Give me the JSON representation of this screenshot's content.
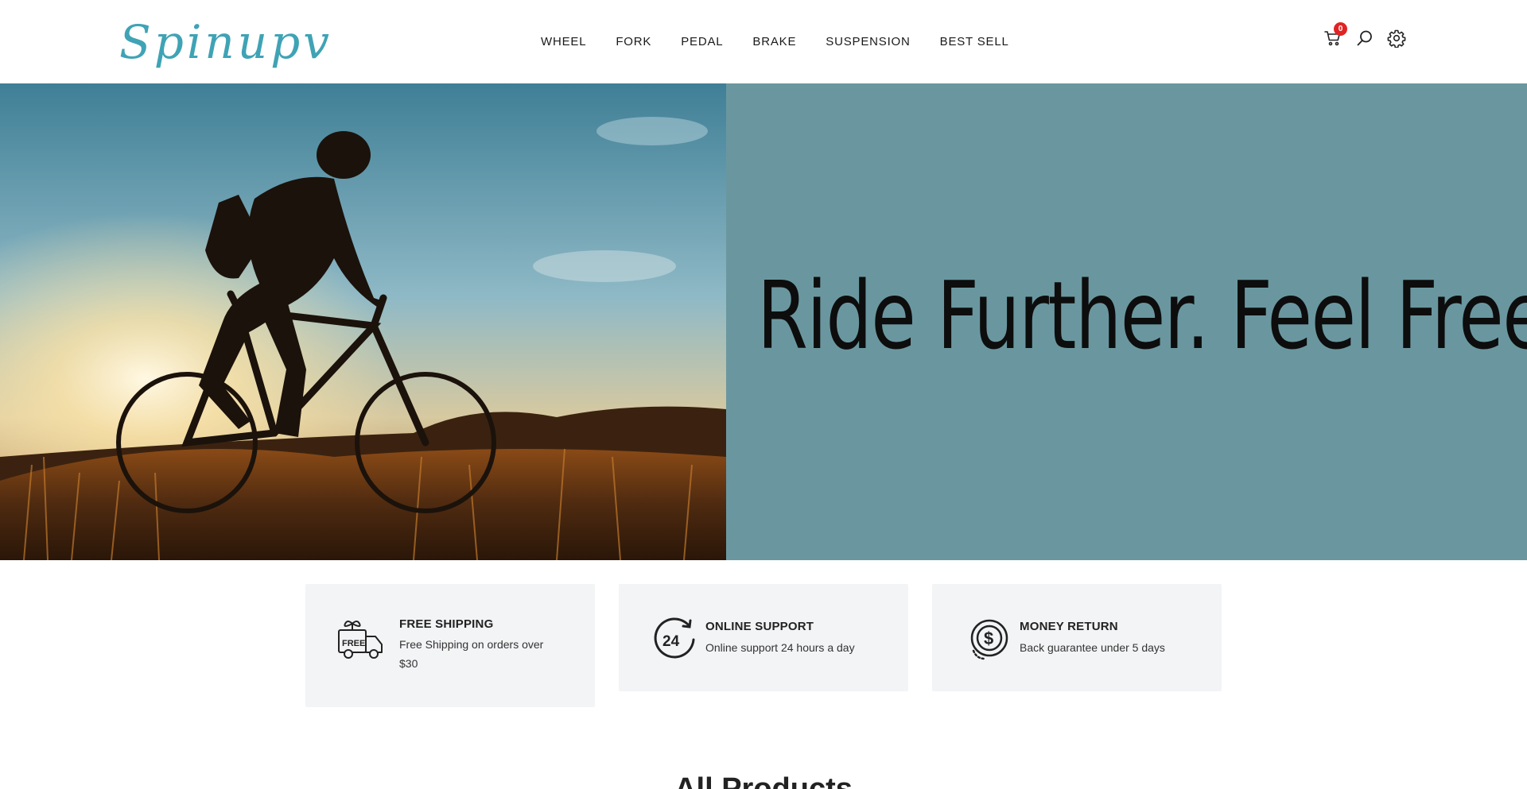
{
  "brand": {
    "logo_text": "Spinupv",
    "accent_color": "#3fa3b5"
  },
  "nav": {
    "items": [
      "WHEEL",
      "FORK",
      "PEDAL",
      "BRAKE",
      "SUSPENSION",
      "BEST SELL"
    ]
  },
  "header_icons": {
    "cart": {
      "icon": "cart-icon",
      "count": "0"
    },
    "search": {
      "icon": "search-icon"
    },
    "settings": {
      "icon": "gear-icon"
    }
  },
  "hero": {
    "headline": "Ride Further. Feel Free.",
    "background_color": "#6a979f",
    "image": "cyclist-silhouette-sunset"
  },
  "features": [
    {
      "icon": "free-delivery-truck-icon",
      "title": "FREE SHIPPING",
      "description": "Free Shipping on orders over $30"
    },
    {
      "icon": "24-hours-support-icon",
      "title": "ONLINE SUPPORT",
      "description": "Online support 24 hours a day"
    },
    {
      "icon": "money-return-icon",
      "title": "MONEY RETURN",
      "description": "Back guarantee under 5 days"
    }
  ],
  "products_section": {
    "title": "All Products"
  }
}
